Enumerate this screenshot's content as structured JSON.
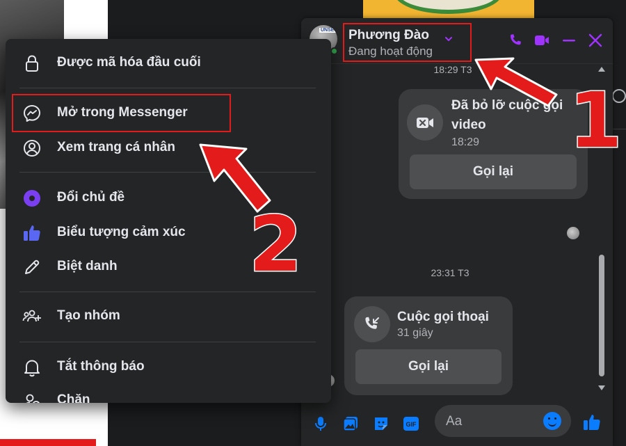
{
  "chat": {
    "contact_name": "Phương Đào",
    "contact_status": "Đang hoạt động",
    "avatar_badge": "UNSEI",
    "messages": [
      {
        "timestamp": "18:29 T3",
        "call_title_line1": "Đã bỏ lỡ cuộc gọi",
        "call_title_line2": "video",
        "call_time": "18:29",
        "callback_label": "Gọi lại"
      },
      {
        "timestamp": "23:31 T3",
        "call_title": "Cuộc gọi thoại",
        "call_duration": "31 giây",
        "callback_label": "Gọi lại"
      }
    ],
    "composer": {
      "placeholder": "Aa",
      "icons": [
        "microphone-icon",
        "photo-icon",
        "sticker-icon",
        "gif-icon",
        "emoji-icon",
        "like-icon"
      ]
    },
    "header_icons": [
      "phone-icon",
      "video-call-icon",
      "minimize-icon",
      "close-icon"
    ]
  },
  "menu": {
    "items": [
      {
        "label": "Được mã hóa đầu cuối",
        "icon": "lock-icon"
      },
      {
        "label": "Mở trong Messenger",
        "icon": "messenger-icon"
      },
      {
        "label": "Xem trang cá nhân",
        "icon": "profile-icon"
      },
      {
        "label": "Đổi chủ đề",
        "icon": "theme-icon"
      },
      {
        "label": "Biểu tượng cảm xúc",
        "icon": "thumbs-up-icon"
      },
      {
        "label": "Biệt danh",
        "icon": "pencil-icon"
      },
      {
        "label": "Tạo nhóm",
        "icon": "group-icon"
      },
      {
        "label": "Tắt thông báo",
        "icon": "bell-icon"
      },
      {
        "label": "Chặn",
        "icon": "block-user-icon"
      }
    ]
  },
  "annotations": {
    "step1": "1",
    "step2": "2"
  },
  "colors": {
    "accent": "#a033ff",
    "messenger_blue": "#0a7cff",
    "annotation_red": "#e41b1b",
    "panel_bg": "#242526",
    "bubble_bg": "#3a3b3c"
  }
}
